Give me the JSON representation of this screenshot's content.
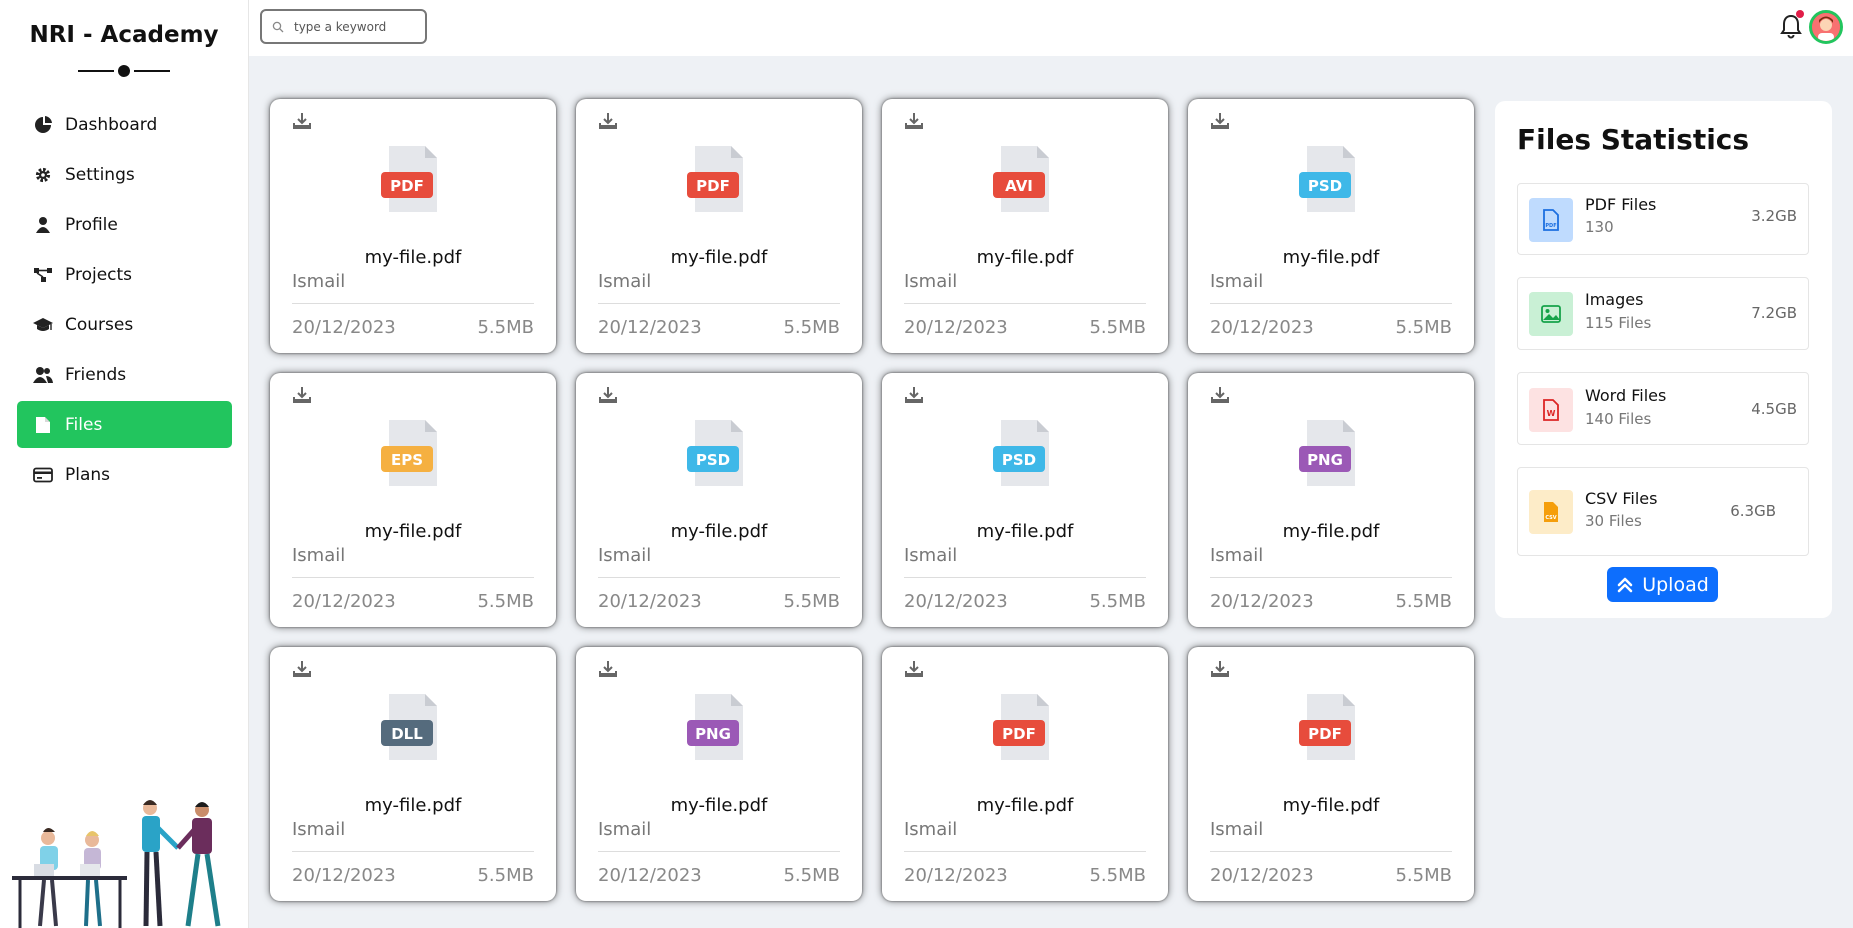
{
  "app": {
    "title": "NRI - Academy"
  },
  "search": {
    "placeholder": "type a keyword"
  },
  "sidebar": {
    "items": [
      {
        "label": "Dashboard",
        "icon": "pie-chart-icon",
        "active": false
      },
      {
        "label": "Settings",
        "icon": "gear-icon",
        "active": false
      },
      {
        "label": "Profile",
        "icon": "user-icon",
        "active": false
      },
      {
        "label": "Projects",
        "icon": "diagram-icon",
        "active": false
      },
      {
        "label": "Courses",
        "icon": "graduation-cap-icon",
        "active": false
      },
      {
        "label": "Friends",
        "icon": "users-icon",
        "active": false
      },
      {
        "label": "Files",
        "icon": "file-icon",
        "active": true
      },
      {
        "label": "Plans",
        "icon": "credit-card-icon",
        "active": false
      }
    ]
  },
  "files": [
    {
      "type": "PDF",
      "color": "#e74c3c",
      "name": "my-file.pdf",
      "owner": "Ismail",
      "date": "20/12/2023",
      "size": "5.5MB"
    },
    {
      "type": "PDF",
      "color": "#e74c3c",
      "name": "my-file.pdf",
      "owner": "Ismail",
      "date": "20/12/2023",
      "size": "5.5MB"
    },
    {
      "type": "AVI",
      "color": "#e74c3c",
      "name": "my-file.pdf",
      "owner": "Ismail",
      "date": "20/12/2023",
      "size": "5.5MB"
    },
    {
      "type": "PSD",
      "color": "#3eb8e8",
      "name": "my-file.pdf",
      "owner": "Ismail",
      "date": "20/12/2023",
      "size": "5.5MB"
    },
    {
      "type": "EPS",
      "color": "#f5b041",
      "name": "my-file.pdf",
      "owner": "Ismail",
      "date": "20/12/2023",
      "size": "5.5MB"
    },
    {
      "type": "PSD",
      "color": "#3eb8e8",
      "name": "my-file.pdf",
      "owner": "Ismail",
      "date": "20/12/2023",
      "size": "5.5MB"
    },
    {
      "type": "PSD",
      "color": "#3eb8e8",
      "name": "my-file.pdf",
      "owner": "Ismail",
      "date": "20/12/2023",
      "size": "5.5MB"
    },
    {
      "type": "PNG",
      "color": "#9b59b6",
      "name": "my-file.pdf",
      "owner": "Ismail",
      "date": "20/12/2023",
      "size": "5.5MB"
    },
    {
      "type": "DLL",
      "color": "#556b7d",
      "name": "my-file.pdf",
      "owner": "Ismail",
      "date": "20/12/2023",
      "size": "5.5MB"
    },
    {
      "type": "PNG",
      "color": "#9b59b6",
      "name": "my-file.pdf",
      "owner": "Ismail",
      "date": "20/12/2023",
      "size": "5.5MB"
    },
    {
      "type": "PDF",
      "color": "#e74c3c",
      "name": "my-file.pdf",
      "owner": "Ismail",
      "date": "20/12/2023",
      "size": "5.5MB"
    },
    {
      "type": "PDF",
      "color": "#e74c3c",
      "name": "my-file.pdf",
      "owner": "Ismail",
      "date": "20/12/2023",
      "size": "5.5MB"
    }
  ],
  "stats": {
    "title": "Files Statistics",
    "items": [
      {
        "title": "PDF Files",
        "sub": "130",
        "size": "3.2GB",
        "icon": "pdf-file-icon",
        "bg": "#bfdbfe",
        "fg": "#1d6fe0"
      },
      {
        "title": "Images",
        "sub": "115 Files",
        "size": "7.2GB",
        "icon": "image-icon",
        "bg": "#c9f0d5",
        "fg": "#16a34a"
      },
      {
        "title": "Word Files",
        "sub": "140 Files",
        "size": "4.5GB",
        "icon": "word-file-icon",
        "bg": "#fde2e2",
        "fg": "#dc2626"
      },
      {
        "title": "CSV Files",
        "sub": "30 Files",
        "size": "6.3GB",
        "icon": "csv-file-icon",
        "bg": "#fdecc8",
        "fg": "#f59e0b"
      }
    ],
    "upload_label": "Upload"
  }
}
